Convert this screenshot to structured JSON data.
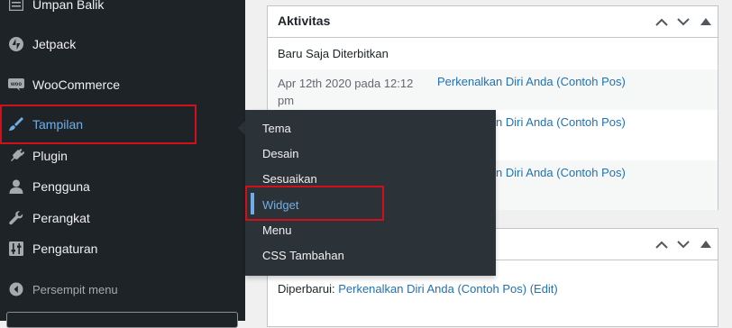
{
  "sidebar": {
    "items": [
      {
        "label": "Umpan Balik",
        "icon": "feedback-icon"
      },
      {
        "label": "Jetpack",
        "icon": "jetpack-icon"
      },
      {
        "label": "WooCommerce",
        "icon": "woocommerce-icon"
      },
      {
        "label": "Tampilan",
        "icon": "paintbrush-icon"
      },
      {
        "label": "Plugin",
        "icon": "plugin-icon"
      },
      {
        "label": "Pengguna",
        "icon": "user-icon"
      },
      {
        "label": "Perangkat",
        "icon": "wrench-icon"
      },
      {
        "label": "Pengaturan",
        "icon": "settings-icon"
      }
    ],
    "collapse_label": "Persempit menu"
  },
  "submenu": {
    "items": [
      "Tema",
      "Desain",
      "Sesuaikan",
      "Widget",
      "Menu",
      "CSS Tambahan"
    ],
    "current": "Widget"
  },
  "activity": {
    "title": "Aktivitas",
    "section_label": "Baru Saja Diterbitkan",
    "rows": [
      {
        "date": "Apr 12th 2020 pada 12:12 pm",
        "link": "Perkenalkan Diri Anda (Contoh Pos)"
      },
      {
        "date": "",
        "link": "Perkenalkan Diri Anda (Contoh Pos)"
      },
      {
        "date": "",
        "link": "Perkenalkan Diri Anda (Contoh Pos)"
      }
    ]
  },
  "drafts": {
    "updated_label": "Diperbarui:",
    "updated_link": "Perkenalkan Diri Anda (Contoh Pos)",
    "edit_label": "(Edit)"
  },
  "colors": {
    "sidebar_bg": "#1d2327",
    "submenu_bg": "#2c3338",
    "accent": "#72aee6",
    "link": "#2271b1",
    "highlight_border": "#d0101b"
  }
}
